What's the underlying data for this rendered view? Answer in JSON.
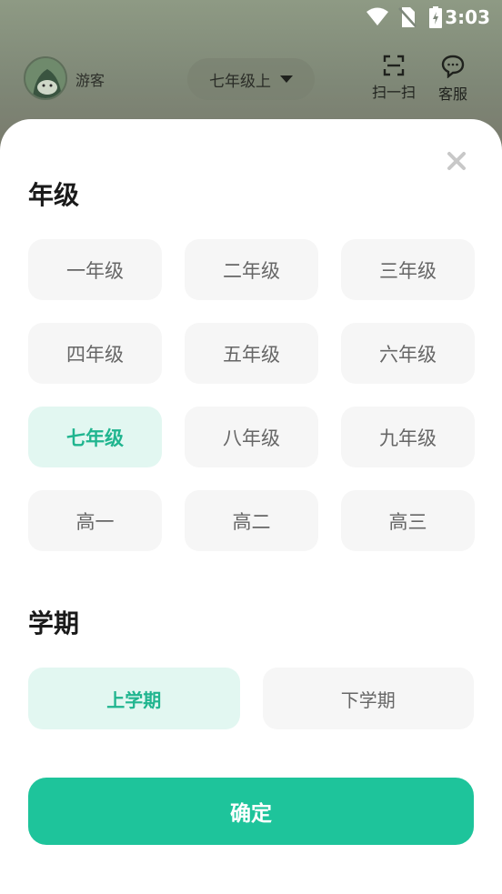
{
  "status_bar": {
    "time": "3:03"
  },
  "header": {
    "avatar_icon": "mascot-avatar-icon",
    "guest_label": "游客",
    "grade_selector": "七年级上",
    "scan_label": "扫一扫",
    "service_label": "客服"
  },
  "sheet": {
    "grade_title": "年级",
    "grades": [
      [
        "一年级",
        "二年级",
        "三年级"
      ],
      [
        "四年级",
        "五年级",
        "六年级"
      ],
      [
        "七年级",
        "八年级",
        "九年级"
      ],
      [
        "高一",
        "高二",
        "高三"
      ]
    ],
    "selected_grade": "七年级",
    "term_title": "学期",
    "terms": [
      "上学期",
      "下学期"
    ],
    "selected_term": "上学期",
    "confirm_label": "确定"
  },
  "colors": {
    "accent": "#1ec49b",
    "selected_bg": "#e2f7f1",
    "selected_text": "#20b58f",
    "option_bg": "#f6f6f6"
  }
}
